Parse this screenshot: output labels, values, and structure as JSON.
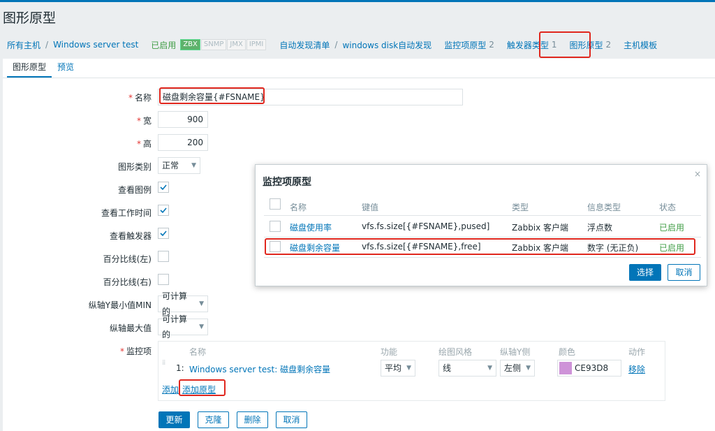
{
  "page_title": "图形原型",
  "breadcrumbs": {
    "all_hosts": "所有主机",
    "sep": "/",
    "host": "Windows server test",
    "enabled": "已启用",
    "badges": [
      "ZBX",
      "SNMP",
      "JMX",
      "IPMI"
    ],
    "discovery_list": "自动发现清单",
    "discovery_rule": "windows disk自动发现",
    "item_prototypes": "监控项原型",
    "item_prototypes_count": "2",
    "trigger_types": "触发器类型",
    "trigger_types_count": "1",
    "graph_prototypes": "图形原型",
    "graph_prototypes_count": "2",
    "host_templates": "主机模板"
  },
  "tabs": [
    "图形原型",
    "预览"
  ],
  "form": {
    "name_label": "名称",
    "name_value": "磁盘剩余容量{#FSNAME}",
    "width_label": "宽",
    "width_value": "900",
    "height_label": "高",
    "height_value": "200",
    "graph_type_label": "图形类别",
    "graph_type_value": "正常",
    "show_legend_label": "查看图例",
    "show_legend_checked": true,
    "show_working_time_label": "查看工作时间",
    "show_working_time_checked": true,
    "show_triggers_label": "查看触发器",
    "show_triggers_checked": true,
    "percentile_left_label": "百分比线(左)",
    "percentile_left_checked": false,
    "percentile_right_label": "百分比线(右)",
    "percentile_right_checked": false,
    "ymin_label": "纵轴Y最小值MIN",
    "ymin_value": "可计算的",
    "ymax_label": "纵轴最大值",
    "ymax_value": "可计算的",
    "items_label": "监控项",
    "items_headers": {
      "name": "名称",
      "function": "功能",
      "draw_style": "绘图风格",
      "y_axis": "纵轴Y侧",
      "color": "颜色",
      "action": "动作"
    },
    "items": [
      {
        "index": "1:",
        "name": "Windows server test: 磁盘剩余容量",
        "function": "平均",
        "draw_style": "线",
        "y_axis": "左侧",
        "color": "CE93D8",
        "color_hex": "#CE93D8",
        "action": "移除"
      }
    ],
    "add_link": "添加",
    "add_prototype_link": "添加原型"
  },
  "buttons": {
    "update": "更新",
    "clone": "克隆",
    "delete": "删除",
    "cancel": "取消"
  },
  "dialog": {
    "title": "监控项原型",
    "close": "×",
    "headers": {
      "name": "名称",
      "key": "键值",
      "type": "类型",
      "info_type": "信息类型",
      "status": "状态"
    },
    "rows": [
      {
        "name": "磁盘使用率",
        "key": "vfs.fs.size[{#FSNAME},pused]",
        "type": "Zabbix 客户端",
        "info_type": "浮点数",
        "status": "已启用",
        "checked": false
      },
      {
        "name": "磁盘剩余容量",
        "key": "vfs.fs.size[{#FSNAME},free]",
        "type": "Zabbix 客户端",
        "info_type": "数字 (无正负)",
        "status": "已启用",
        "checked": false
      }
    ],
    "select_button": "选择",
    "cancel_button": "取消"
  },
  "colors": {
    "accent": "#0275b8",
    "enabled_green": "#429e47",
    "required_red": "#e33734",
    "highlight_red": "#e0271e"
  }
}
